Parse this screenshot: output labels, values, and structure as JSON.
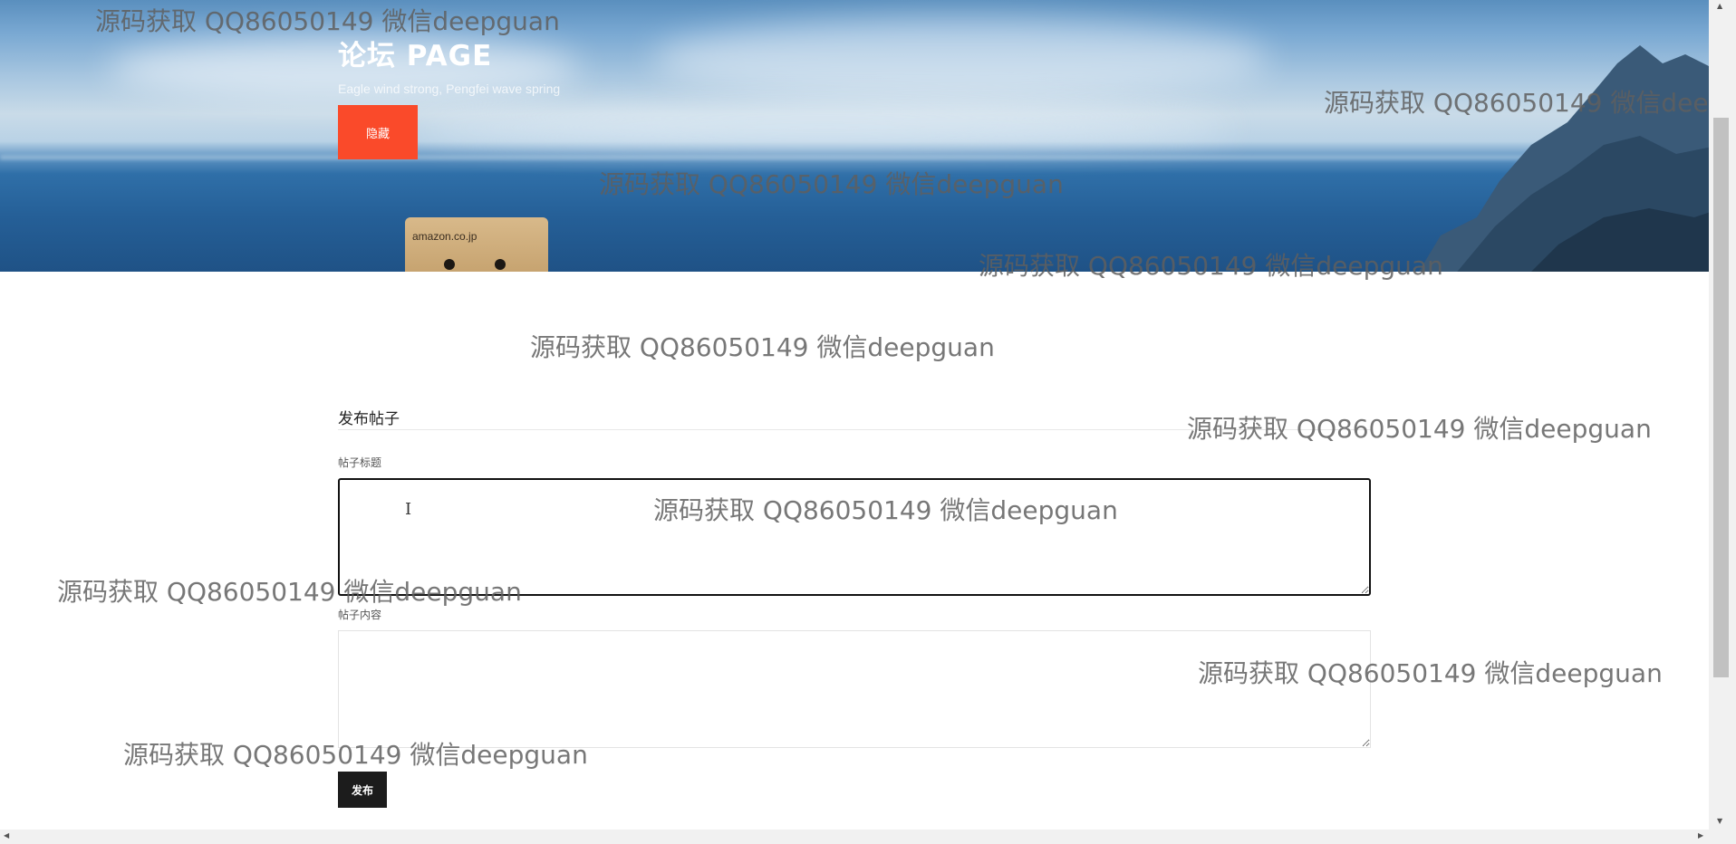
{
  "hero": {
    "title": "论坛 PAGE",
    "subtitle": "Eagle wind strong, Pengfei wave spring",
    "hide_button_label": "隐藏",
    "box_logo": "amazon.co.jp"
  },
  "form": {
    "heading": "发布帖子",
    "title_label": "帖子标题",
    "title_value": "",
    "content_label": "帖子内容",
    "content_value": "",
    "publish_button_label": "发布"
  },
  "watermark_text": "源码获取 QQ86050149 微信deepguan",
  "colors": {
    "hide_button": "#fa4a2a",
    "publish_button": "#1c1c1c",
    "focused_border": "#111111"
  },
  "icons": {
    "text_cursor": "i-beam-cursor-icon",
    "scroll_up": "arrow-up-icon",
    "scroll_down": "arrow-down-icon",
    "scroll_left": "arrow-left-icon",
    "scroll_right": "arrow-right-icon"
  }
}
